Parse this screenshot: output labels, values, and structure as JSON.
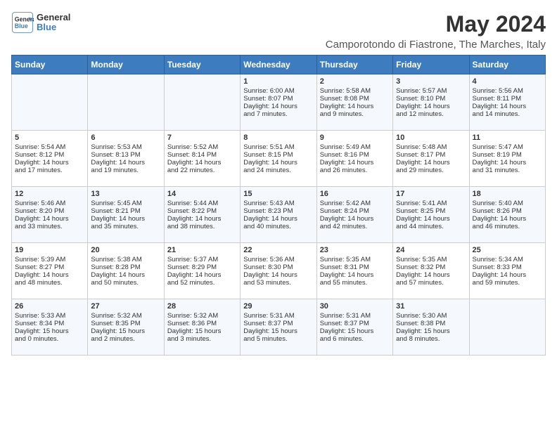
{
  "header": {
    "logo_line1": "General",
    "logo_line2": "Blue",
    "title": "May 2024",
    "subtitle": "Camporotondo di Fiastrone, The Marches, Italy"
  },
  "days_of_week": [
    "Sunday",
    "Monday",
    "Tuesday",
    "Wednesday",
    "Thursday",
    "Friday",
    "Saturday"
  ],
  "weeks": [
    [
      {
        "day": "",
        "content": ""
      },
      {
        "day": "",
        "content": ""
      },
      {
        "day": "",
        "content": ""
      },
      {
        "day": "1",
        "content": "Sunrise: 6:00 AM\nSunset: 8:07 PM\nDaylight: 14 hours\nand 7 minutes."
      },
      {
        "day": "2",
        "content": "Sunrise: 5:58 AM\nSunset: 8:08 PM\nDaylight: 14 hours\nand 9 minutes."
      },
      {
        "day": "3",
        "content": "Sunrise: 5:57 AM\nSunset: 8:10 PM\nDaylight: 14 hours\nand 12 minutes."
      },
      {
        "day": "4",
        "content": "Sunrise: 5:56 AM\nSunset: 8:11 PM\nDaylight: 14 hours\nand 14 minutes."
      }
    ],
    [
      {
        "day": "5",
        "content": "Sunrise: 5:54 AM\nSunset: 8:12 PM\nDaylight: 14 hours\nand 17 minutes."
      },
      {
        "day": "6",
        "content": "Sunrise: 5:53 AM\nSunset: 8:13 PM\nDaylight: 14 hours\nand 19 minutes."
      },
      {
        "day": "7",
        "content": "Sunrise: 5:52 AM\nSunset: 8:14 PM\nDaylight: 14 hours\nand 22 minutes."
      },
      {
        "day": "8",
        "content": "Sunrise: 5:51 AM\nSunset: 8:15 PM\nDaylight: 14 hours\nand 24 minutes."
      },
      {
        "day": "9",
        "content": "Sunrise: 5:49 AM\nSunset: 8:16 PM\nDaylight: 14 hours\nand 26 minutes."
      },
      {
        "day": "10",
        "content": "Sunrise: 5:48 AM\nSunset: 8:17 PM\nDaylight: 14 hours\nand 29 minutes."
      },
      {
        "day": "11",
        "content": "Sunrise: 5:47 AM\nSunset: 8:19 PM\nDaylight: 14 hours\nand 31 minutes."
      }
    ],
    [
      {
        "day": "12",
        "content": "Sunrise: 5:46 AM\nSunset: 8:20 PM\nDaylight: 14 hours\nand 33 minutes."
      },
      {
        "day": "13",
        "content": "Sunrise: 5:45 AM\nSunset: 8:21 PM\nDaylight: 14 hours\nand 35 minutes."
      },
      {
        "day": "14",
        "content": "Sunrise: 5:44 AM\nSunset: 8:22 PM\nDaylight: 14 hours\nand 38 minutes."
      },
      {
        "day": "15",
        "content": "Sunrise: 5:43 AM\nSunset: 8:23 PM\nDaylight: 14 hours\nand 40 minutes."
      },
      {
        "day": "16",
        "content": "Sunrise: 5:42 AM\nSunset: 8:24 PM\nDaylight: 14 hours\nand 42 minutes."
      },
      {
        "day": "17",
        "content": "Sunrise: 5:41 AM\nSunset: 8:25 PM\nDaylight: 14 hours\nand 44 minutes."
      },
      {
        "day": "18",
        "content": "Sunrise: 5:40 AM\nSunset: 8:26 PM\nDaylight: 14 hours\nand 46 minutes."
      }
    ],
    [
      {
        "day": "19",
        "content": "Sunrise: 5:39 AM\nSunset: 8:27 PM\nDaylight: 14 hours\nand 48 minutes."
      },
      {
        "day": "20",
        "content": "Sunrise: 5:38 AM\nSunset: 8:28 PM\nDaylight: 14 hours\nand 50 minutes."
      },
      {
        "day": "21",
        "content": "Sunrise: 5:37 AM\nSunset: 8:29 PM\nDaylight: 14 hours\nand 52 minutes."
      },
      {
        "day": "22",
        "content": "Sunrise: 5:36 AM\nSunset: 8:30 PM\nDaylight: 14 hours\nand 53 minutes."
      },
      {
        "day": "23",
        "content": "Sunrise: 5:35 AM\nSunset: 8:31 PM\nDaylight: 14 hours\nand 55 minutes."
      },
      {
        "day": "24",
        "content": "Sunrise: 5:35 AM\nSunset: 8:32 PM\nDaylight: 14 hours\nand 57 minutes."
      },
      {
        "day": "25",
        "content": "Sunrise: 5:34 AM\nSunset: 8:33 PM\nDaylight: 14 hours\nand 59 minutes."
      }
    ],
    [
      {
        "day": "26",
        "content": "Sunrise: 5:33 AM\nSunset: 8:34 PM\nDaylight: 15 hours\nand 0 minutes."
      },
      {
        "day": "27",
        "content": "Sunrise: 5:32 AM\nSunset: 8:35 PM\nDaylight: 15 hours\nand 2 minutes."
      },
      {
        "day": "28",
        "content": "Sunrise: 5:32 AM\nSunset: 8:36 PM\nDaylight: 15 hours\nand 3 minutes."
      },
      {
        "day": "29",
        "content": "Sunrise: 5:31 AM\nSunset: 8:37 PM\nDaylight: 15 hours\nand 5 minutes."
      },
      {
        "day": "30",
        "content": "Sunrise: 5:31 AM\nSunset: 8:37 PM\nDaylight: 15 hours\nand 6 minutes."
      },
      {
        "day": "31",
        "content": "Sunrise: 5:30 AM\nSunset: 8:38 PM\nDaylight: 15 hours\nand 8 minutes."
      },
      {
        "day": "",
        "content": ""
      }
    ]
  ]
}
